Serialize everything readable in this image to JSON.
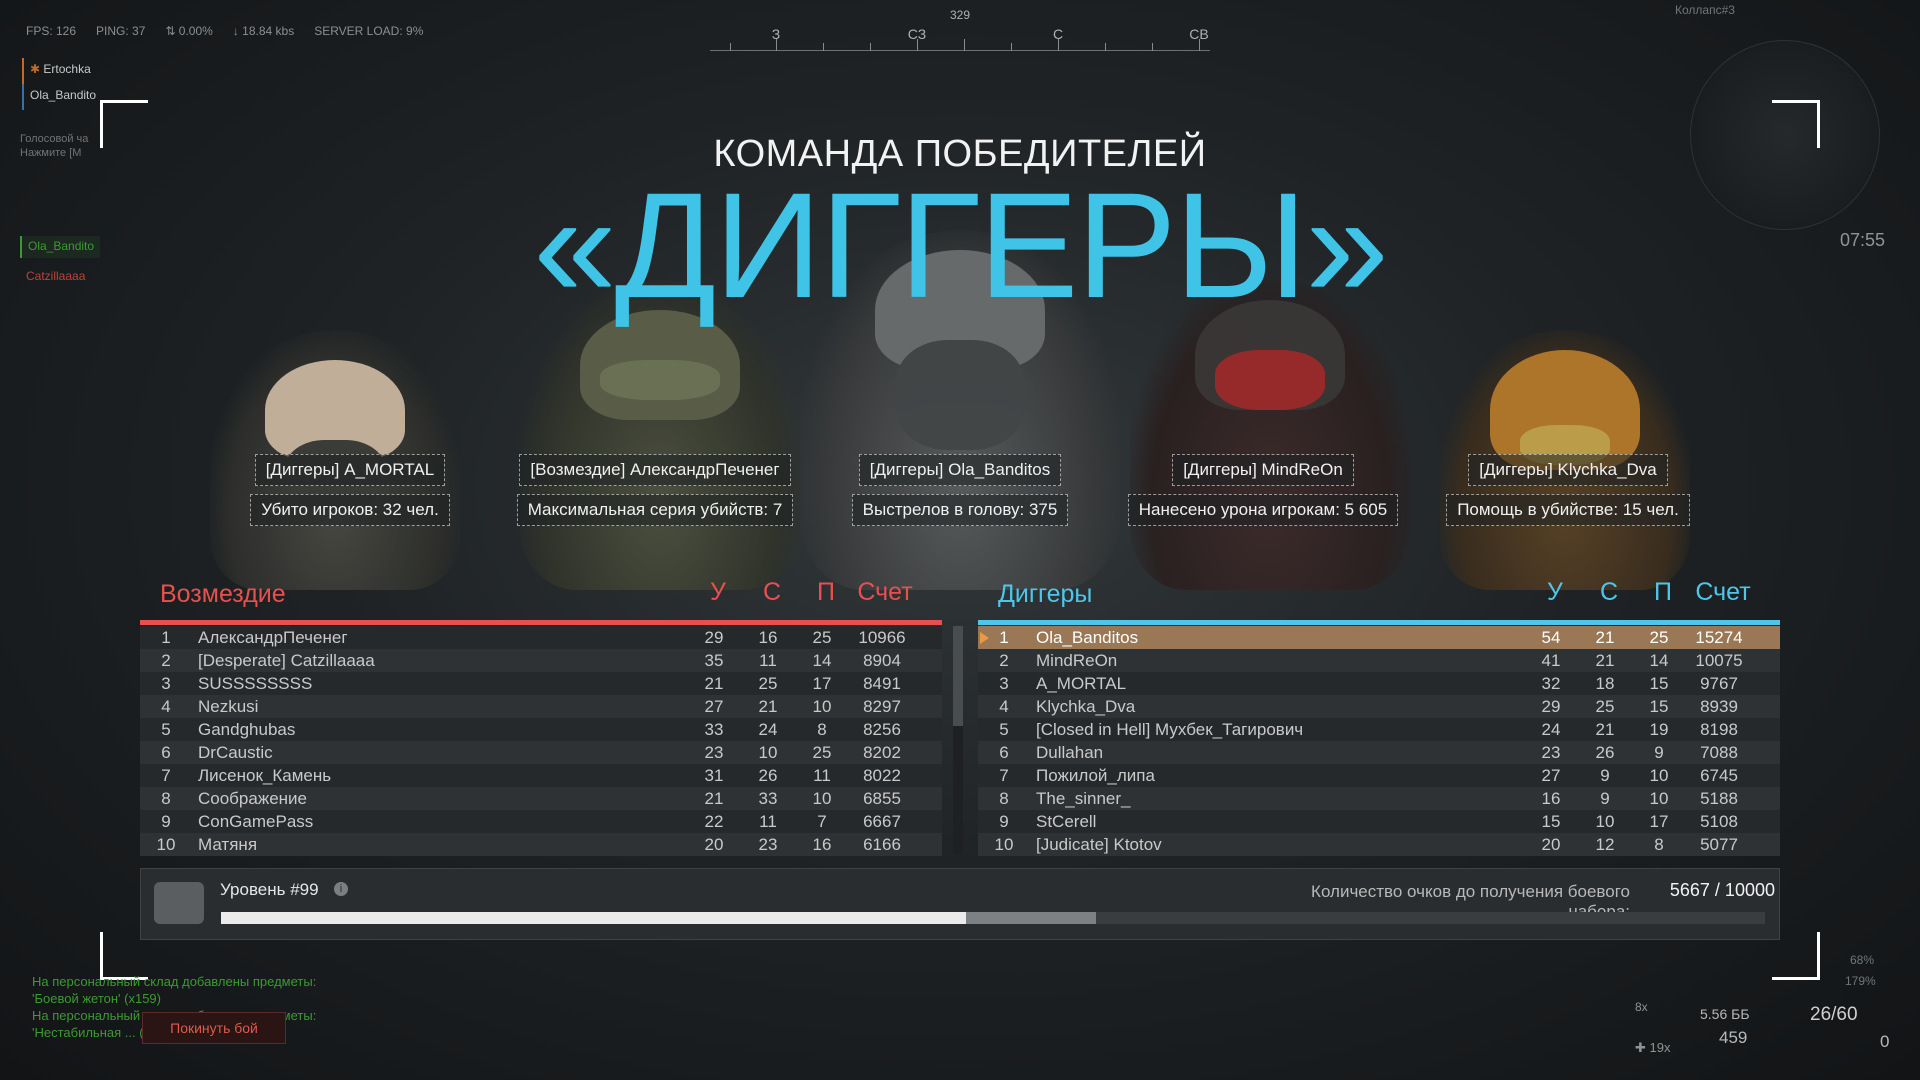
{
  "hud": {
    "fps": "FPS: 126",
    "ping": "PING: 37",
    "loss": "0.00%",
    "speed": "18.84 kbs",
    "server_load": "SERVER LOAD: 9%",
    "compass": {
      "heading": "329",
      "labels": [
        "З",
        "СЗ",
        "С",
        "СВ"
      ]
    },
    "clock": "07:55",
    "minimap_label": "Коллапс#3",
    "ammo": {
      "caliber": "5.56 ББ",
      "reserve": "459",
      "mag": "26/60",
      "grenades": "0",
      "scope": "8x",
      "medkits": "19x"
    },
    "side_pct_1": "68%",
    "side_pct_2": "179%"
  },
  "voice": {
    "players": [
      "Ertochka",
      "Ola_Bandito"
    ],
    "hint_line1": "Голосовой ча",
    "hint_line2": "Нажмите [М"
  },
  "side_tags": {
    "green": "Ola_Bandito",
    "red": "Catzillaaaa"
  },
  "winner": {
    "subtitle": "КОМАНДА ПОБЕДИТЕЛЕЙ",
    "team": "«ДИГГЕРЫ»"
  },
  "awards": [
    {
      "name": "[Диггеры] A_MORTAL",
      "stat": "Убито игроков: 32 чел."
    },
    {
      "name": "[Возмездие] АлександрПеченег",
      "stat": "Максимальная серия убийств: 7"
    },
    {
      "name": "[Диггеры] Ola_Banditos",
      "stat": "Выстрелов в голову: 375"
    },
    {
      "name": "[Диггеры] MindReOn",
      "stat": "Нанесено урона игрокам: 5 605"
    },
    {
      "name": "[Диггеры] Klychka_Dva",
      "stat": "Помощь в убийстве: 15 чел."
    }
  ],
  "columns": {
    "k": "У",
    "d": "С",
    "a": "П",
    "score": "Счет"
  },
  "team_left": {
    "name": "Возмездие",
    "color": "#e85050",
    "rows": [
      {
        "rank": "1",
        "name": "АлександрПеченег",
        "k": "29",
        "d": "16",
        "a": "25",
        "score": "10966"
      },
      {
        "rank": "2",
        "name": "[Desperate] Catzillaaaa",
        "k": "35",
        "d": "11",
        "a": "14",
        "score": "8904"
      },
      {
        "rank": "3",
        "name": "SUSSSSSSSS",
        "k": "21",
        "d": "25",
        "a": "17",
        "score": "8491"
      },
      {
        "rank": "4",
        "name": "Nezkusi",
        "k": "27",
        "d": "21",
        "a": "10",
        "score": "8297"
      },
      {
        "rank": "5",
        "name": "Gandghubas",
        "k": "33",
        "d": "24",
        "a": "8",
        "score": "8256"
      },
      {
        "rank": "6",
        "name": "DrCaustic",
        "k": "23",
        "d": "10",
        "a": "25",
        "score": "8202"
      },
      {
        "rank": "7",
        "name": "Лисенок_Камень",
        "k": "31",
        "d": "26",
        "a": "11",
        "score": "8022"
      },
      {
        "rank": "8",
        "name": "Соображение",
        "k": "21",
        "d": "33",
        "a": "10",
        "score": "6855"
      },
      {
        "rank": "9",
        "name": "ConGamePass",
        "k": "22",
        "d": "11",
        "a": "7",
        "score": "6667"
      },
      {
        "rank": "10",
        "name": "Матяня",
        "k": "20",
        "d": "23",
        "a": "16",
        "score": "6166"
      }
    ]
  },
  "team_right": {
    "name": "Диггеры",
    "color": "#4ec6ea",
    "rows": [
      {
        "rank": "1",
        "name": "Ola_Banditos",
        "k": "54",
        "d": "21",
        "a": "25",
        "score": "15274",
        "self": true
      },
      {
        "rank": "2",
        "name": "MindReOn",
        "k": "41",
        "d": "21",
        "a": "14",
        "score": "10075"
      },
      {
        "rank": "3",
        "name": "A_MORTAL",
        "k": "32",
        "d": "18",
        "a": "15",
        "score": "9767"
      },
      {
        "rank": "4",
        "name": "Klychka_Dva",
        "k": "29",
        "d": "25",
        "a": "15",
        "score": "8939"
      },
      {
        "rank": "5",
        "name": "[Closed in Hell] Мухбек_Тагирович",
        "k": "24",
        "d": "21",
        "a": "19",
        "score": "8198"
      },
      {
        "rank": "6",
        "name": "Dullahan",
        "k": "23",
        "d": "26",
        "a": "9",
        "score": "7088"
      },
      {
        "rank": "7",
        "name": "Пожилой_липа",
        "k": "27",
        "d": "9",
        "a": "10",
        "score": "6745"
      },
      {
        "rank": "8",
        "name": "The_sinner_",
        "k": "16",
        "d": "9",
        "a": "10",
        "score": "5188"
      },
      {
        "rank": "9",
        "name": "StCerell",
        "k": "15",
        "d": "10",
        "a": "17",
        "score": "5108"
      },
      {
        "rank": "10",
        "name": "[Judicate] Ktotov",
        "k": "20",
        "d": "12",
        "a": "8",
        "score": "5077"
      }
    ]
  },
  "level": {
    "label": "Уровень #99",
    "info": "i",
    "points_label": "Количество очков до получения боевого набора:",
    "points_value": "5667 / 10000",
    "progress": 0.4825,
    "progress_secondary": 0.5665
  },
  "chat": {
    "line1": "На персональный склад добавлены предметы:",
    "line2": "'Боевой жетон' (x159)",
    "line3": "На персональный склад добавлены предметы:",
    "line4": "'Нестабильная ... (x5)"
  },
  "leave_button": "Покинуть бой"
}
